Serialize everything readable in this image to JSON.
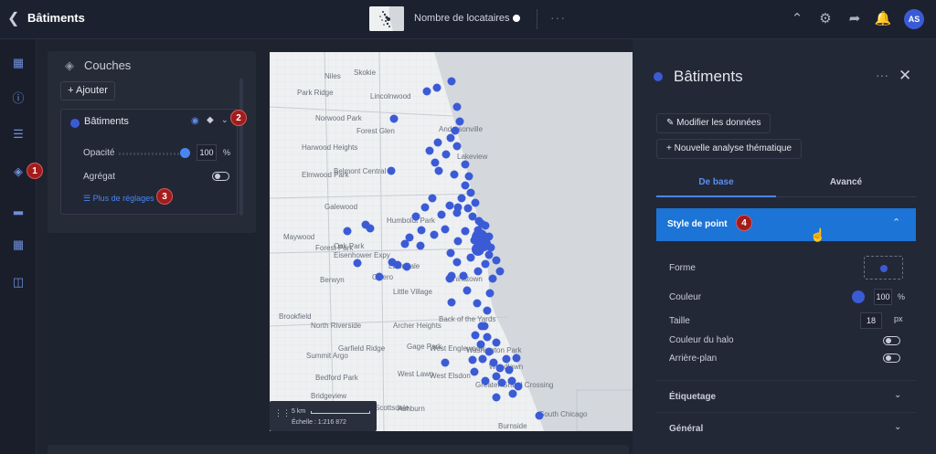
{
  "topbar": {
    "back_icon": "chevron-left-icon",
    "title": "Bâtiments",
    "layer_label": "Nombre de locataires",
    "more": "···",
    "avatar_initials": "AS",
    "icons": [
      "collapse-up-icon",
      "gear-icon",
      "share-icon",
      "bell-icon"
    ]
  },
  "rail": {
    "icons": [
      "map-icon",
      "info-icon",
      "list-icon",
      "layers-icon",
      "chart-icon",
      "table-icon",
      "book-icon"
    ]
  },
  "layers_panel": {
    "title": "Couches",
    "add_label": "Ajouter",
    "layer": {
      "name": "Bâtiments",
      "color": "#3b5bd6",
      "opacity_label": "Opacité",
      "opacity_value": "100",
      "opacity_unit": "%",
      "opacity_fraction": 1.0,
      "aggregate_label": "Agrégat",
      "aggregate_on": false,
      "more_settings": "Plus de réglages"
    }
  },
  "badges": [
    "1",
    "2",
    "3",
    "4"
  ],
  "map": {
    "labels": [
      "Skokie",
      "Niles",
      "Park Ridge",
      "Lincolnwood",
      "Norwood Park",
      "Forest Glen",
      "Harwood Heights",
      "Elmwood Park",
      "Belmont Central",
      "Galewood",
      "Humboldt Park",
      "Maywood",
      "Forest Park",
      "Oak Park",
      "Berwyn",
      "Cicero",
      "Lawndale",
      "Little Village",
      "Brookfield",
      "North Riverside",
      "Archer Heights",
      "Gage Park",
      "West Lawn",
      "West Elsdon",
      "Garfield Ridge",
      "Summit Argo",
      "Bedford Park",
      "Bridgeview",
      "Scottsdale",
      "Ashburn",
      "Greater Grand Crossing",
      "Burnside",
      "Washington Park",
      "Woodlawn",
      "West Englewood",
      "Back of the Yards",
      "Andersonville",
      "Lakeview",
      "Chinatown",
      "South Chicago",
      "Eisenhower Expy"
    ],
    "scale_km": "5 km",
    "scale_ratio": "Échelle : 1:216 872"
  },
  "right_panel": {
    "title": "Bâtiments",
    "more": "···",
    "close_icon": "close-icon",
    "edit_data": "Modifier les données",
    "new_analysis": "Nouvelle analyse thématique",
    "tabs": [
      "De base",
      "Avancé"
    ],
    "style_section": "Style de point",
    "props": {
      "shape_label": "Forme",
      "color_label": "Couleur",
      "color_opacity": "100",
      "color_unit": "%",
      "size_label": "Taille",
      "size_value": "18",
      "size_unit": "px",
      "halo_label": "Couleur du halo",
      "background_label": "Arrière-plan"
    },
    "sections": [
      "Étiquetage",
      "Général"
    ]
  }
}
